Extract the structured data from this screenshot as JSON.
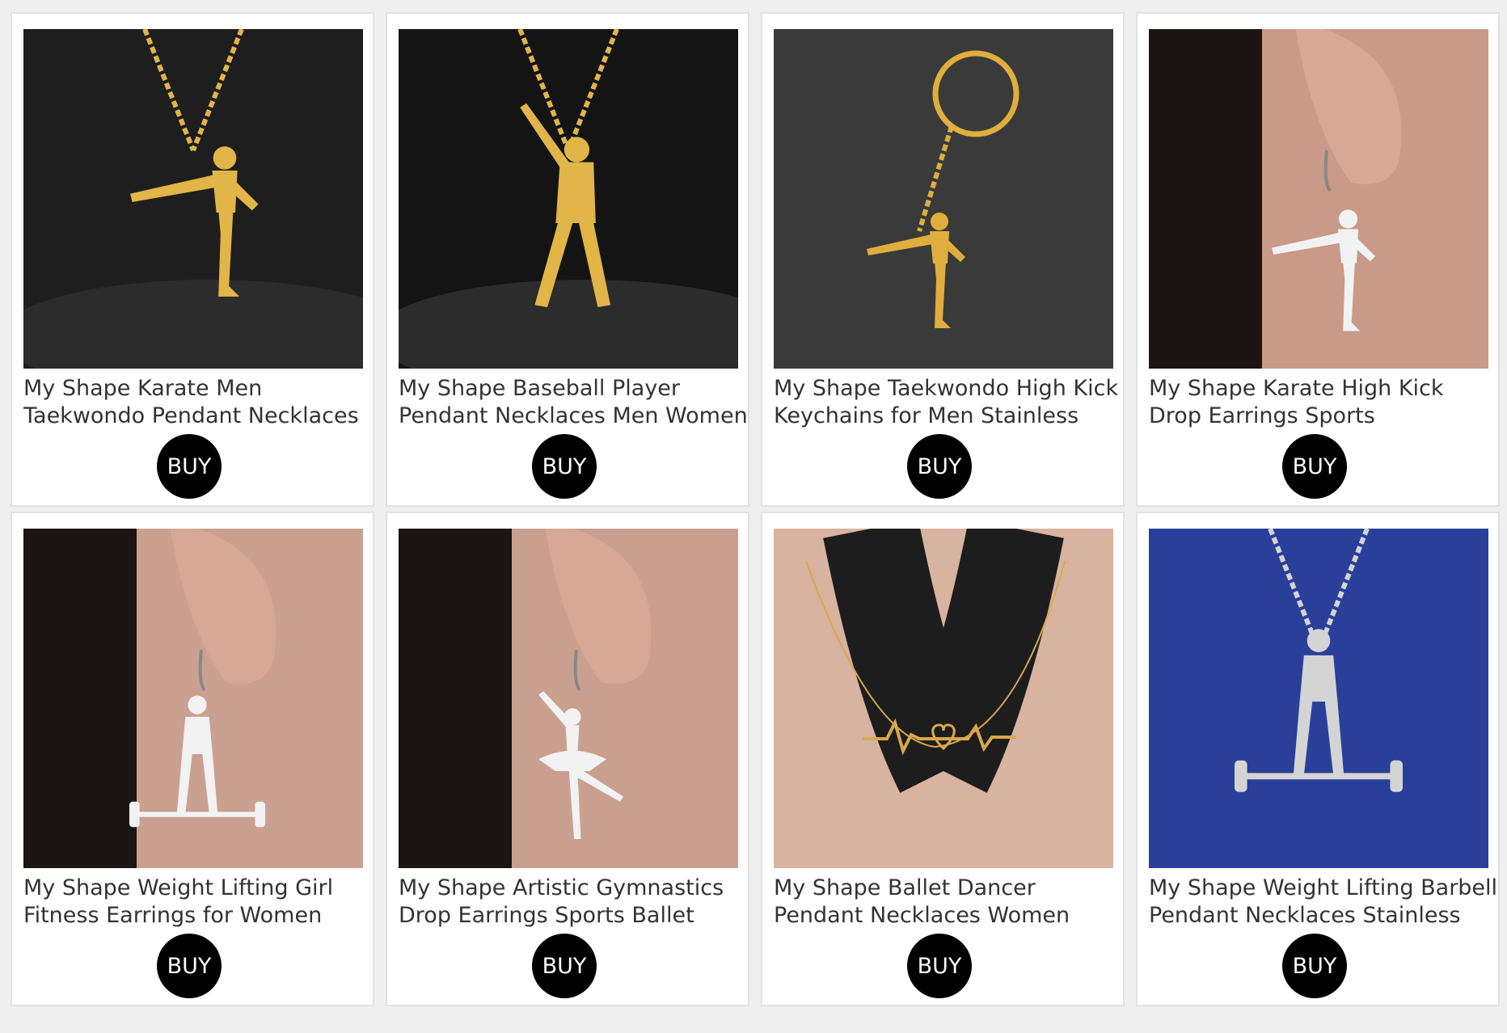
{
  "products": [
    {
      "title": "My Shape Karate Men Taekwondo Pendant Necklaces",
      "buy_label": "BUY",
      "image": "gold-karate-kick-pendant-necklace",
      "bg": "#1e1e1e",
      "metal": "#e2b548"
    },
    {
      "title": "My Shape Baseball Player Pendant Necklaces Men Women",
      "buy_label": "BUY",
      "image": "gold-baseball-batter-pendant-necklace",
      "bg": "#141414",
      "metal": "#e2b548"
    },
    {
      "title": "My Shape Taekwondo High Kick Keychains for Men Stainless Steel",
      "buy_label": "BUY",
      "image": "gold-taekwondo-keychain",
      "bg": "#3a3a3a",
      "metal": "#e0ae3e"
    },
    {
      "title": "My Shape Karate High Kick Drop Earrings Sports Taekwondo Jiu",
      "buy_label": "BUY",
      "image": "silver-karate-kick-earring",
      "bg": "#c99a88",
      "metal": "#f2f2f2"
    },
    {
      "title": "My Shape Weight Lifting Girl Fitness Earrings for Women",
      "buy_label": "BUY",
      "image": "silver-weightlifting-girl-earring",
      "bg": "#caa091",
      "metal": "#f2f2f2"
    },
    {
      "title": "My Shape Artistic Gymnastics Drop Earrings Sports Ballet",
      "buy_label": "BUY",
      "image": "silver-ballerina-earring",
      "bg": "#c9a08f",
      "metal": "#f2f2f2"
    },
    {
      "title": "My Shape Ballet Dancer Pendant Necklaces Women Ballerina",
      "buy_label": "BUY",
      "image": "gold-ballet-heartbeat-necklace",
      "bg": "#d8b3a0",
      "metal": "#d9a84a"
    },
    {
      "title": "My Shape Weight Lifting Barbell Pendant Necklaces Stainless Steel",
      "buy_label": "BUY",
      "image": "silver-weightlifting-barbell-pendant",
      "bg": "#2a3f9a",
      "metal": "#d4d4d4"
    }
  ]
}
